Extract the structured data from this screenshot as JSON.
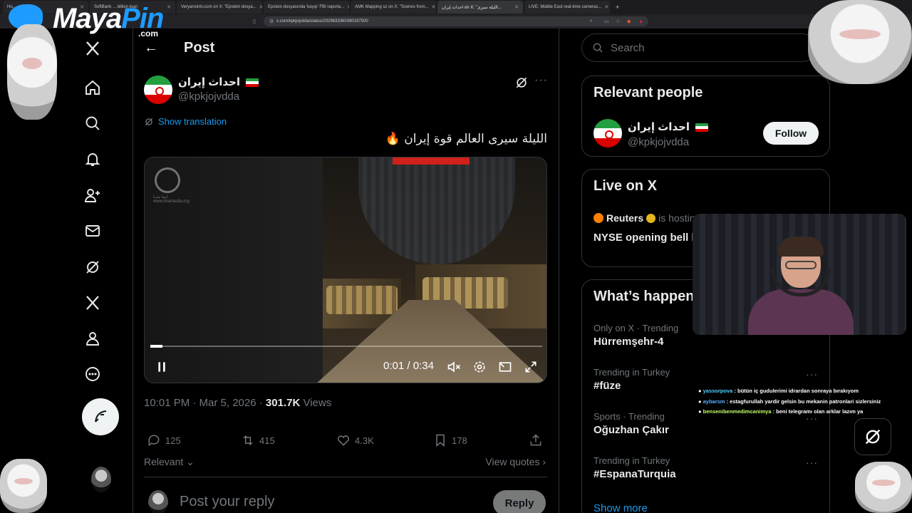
{
  "browser": {
    "tabs": [
      {
        "title": "Ho..."
      },
      {
        "title": "SoftBank ... billion loan"
      },
      {
        "title": "Veryansintv.com on X: \"Epstein dosya..."
      },
      {
        "title": "Epstein dosyasında 'kayıp' FBI raporla..."
      },
      {
        "title": "AMK Mapping sz on X: \"Scenes from..."
      },
      {
        "title": "احداث إيران on X: \"الليلة سيرى..."
      },
      {
        "title": "LIVE: Middle East real-time cameras..."
      }
    ],
    "url": "x.com/kpkjojvdda/status/2029633360390197500"
  },
  "overlay": {
    "logo_main": "Maya",
    "logo_accent": "Pin",
    "logo_suffix": ".com"
  },
  "nav": {
    "items": [
      "x-logo",
      "home",
      "explore",
      "notifications",
      "follow",
      "messages",
      "grok",
      "premium",
      "profile",
      "more"
    ]
  },
  "header": {
    "back": "←",
    "title": "Post"
  },
  "post": {
    "author_name": "احداث إيران",
    "author_handle": "@kpkjojvdda",
    "show_translation": "Show translation",
    "text": "الليلة سيرى العالم قوة إيران 🔥",
    "video": {
      "watermark": "ایما مدیا\nwww.imamedia.org",
      "current_time": "0:01",
      "separator": " / ",
      "duration": "0:34",
      "progress_fraction": 0.03
    },
    "time": "10:01 PM · Mar 5, 2026 · ",
    "views_count": "301.7K",
    "views_label": " Views",
    "replies": "125",
    "reposts": "415",
    "likes": "4.3K",
    "bookmarks": "178",
    "sort_label": "Relevant",
    "quotes_label": "View quotes",
    "reply_placeholder": "Post your reply",
    "reply_button": "Reply"
  },
  "sidebar": {
    "search_placeholder": "Search",
    "relevant_title": "Relevant people",
    "relevant_name": "احداث إيران",
    "relevant_handle": "@kpkjojvdda",
    "follow_label": "Follow",
    "live_title": "Live on X",
    "live_host": "Reuters",
    "live_hosting": "is hosting",
    "live_event": "NYSE opening bell b... day's trading",
    "happening_title": "What’s happening",
    "trends": [
      {
        "meta": "Only on X · Trending",
        "name": "Hürremşehr-4"
      },
      {
        "meta": "Trending in Turkey",
        "name": "#füze"
      },
      {
        "meta": "Sports · Trending",
        "name": "Oğuzhan Çakır"
      },
      {
        "meta": "Trending in Turkey",
        "name": "#EspanaTurquia"
      }
    ],
    "show_more": "Show more"
  },
  "chat": [
    {
      "user": "yassorpova",
      "msg": " : bütün iç gudulerimi idrardan sonraya bırakıyom"
    },
    {
      "user": "aybarsm",
      "msg": " : estagfurullah yardir gelsin bu mekanin patronlari sizlersiniz"
    },
    {
      "user": "bensenibenmedimcanimya",
      "msg": " : beni telegramı olan arklar lazım ya"
    }
  ],
  "colors": {
    "accent": "#1d9bf0",
    "background": "#000000",
    "text": "#e7e9ea",
    "muted": "#71767b",
    "border": "#2f3336"
  }
}
